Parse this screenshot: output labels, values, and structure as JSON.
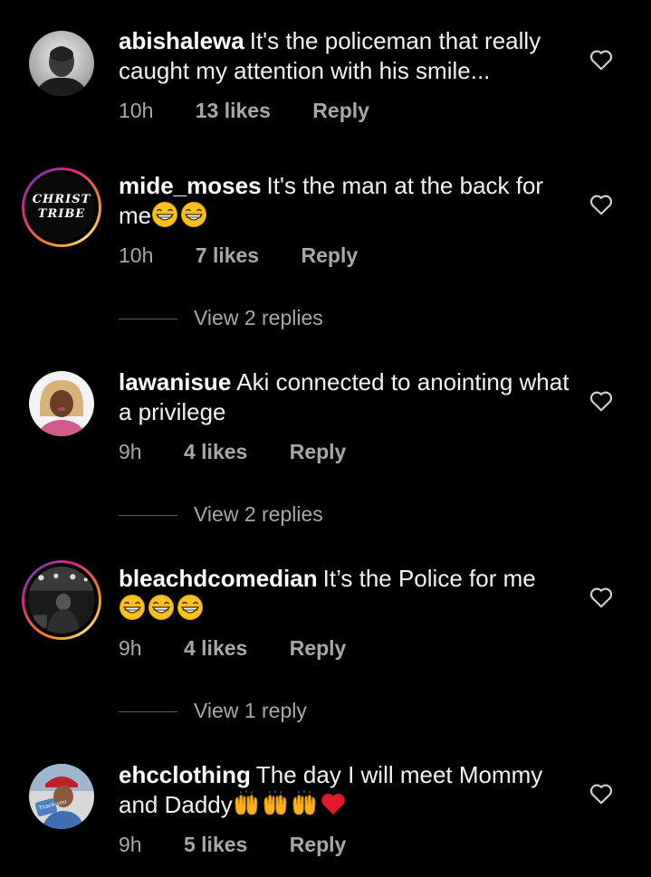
{
  "comments": [
    {
      "username": "abishalewa",
      "text": "It's the policeman that really caught my attention with his smile...",
      "emojis": [],
      "time": "10h",
      "likes": "13 likes",
      "reply": "Reply",
      "view_replies": "",
      "avatar": {
        "style": "plain",
        "colors": [
          "#bdbdbd",
          "#2a2a2a"
        ]
      }
    },
    {
      "username": "mide_moses",
      "text": "It's the man at the back for me",
      "emojis": [
        "grinning-face",
        "grinning-face"
      ],
      "time": "10h",
      "likes": "7 likes",
      "reply": "Reply",
      "view_replies": "View 2 replies",
      "avatar": {
        "style": "ring",
        "logo_lines": [
          "CHRIST",
          "TRIBE"
        ]
      }
    },
    {
      "username": "lawanisue",
      "text": "Aki connected to anointing what a privilege",
      "emojis": [],
      "time": "9h",
      "likes": "4 likes",
      "reply": "Reply",
      "view_replies": "View 2 replies",
      "avatar": {
        "style": "plain",
        "colors": [
          "#e8c9a0",
          "#d25a8c"
        ]
      }
    },
    {
      "username": "bleachdcomedian",
      "text": "It’s the Police for me",
      "emojis": [
        "grinning-face",
        "grinning-face",
        "grinning-face"
      ],
      "time": "9h",
      "likes": "4 likes",
      "reply": "Reply",
      "view_replies": "View 1 reply",
      "avatar": {
        "style": "ring",
        "colors": [
          "#3a3a3a",
          "#0d0d0d"
        ]
      }
    },
    {
      "username": "ehcclothing",
      "text": "The day I will meet Mommy and Daddy",
      "emojis": [
        "raising-hands",
        "raising-hands",
        "raising-hands",
        "red-heart"
      ],
      "time": "9h",
      "likes": "5 likes",
      "reply": "Reply",
      "view_replies": "",
      "avatar": {
        "style": "plain",
        "colors": [
          "#4a7fc1",
          "#d9d9d9"
        ],
        "sign_text": "Thank you"
      }
    }
  ],
  "icons": {
    "heart": "heart-outline-icon"
  },
  "colors": {
    "background": "#000000",
    "text_primary": "#f2f2f2",
    "text_secondary": "#a8a8a8"
  }
}
